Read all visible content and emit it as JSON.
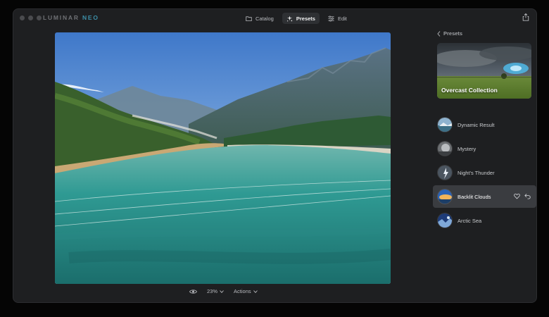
{
  "app": {
    "logo_main": "LUMINAR",
    "logo_accent": "NEO"
  },
  "topnav": {
    "items": [
      {
        "label": "Catalog",
        "icon": "folder-icon",
        "active": false
      },
      {
        "label": "Presets",
        "icon": "sparkle-icon",
        "active": true
      },
      {
        "label": "Edit",
        "icon": "sliders-icon",
        "active": false
      }
    ]
  },
  "bottombar": {
    "zoom": "23%",
    "actions_label": "Actions"
  },
  "sidebar": {
    "back_label": "Presets",
    "collection_title": "Overcast Collection",
    "presets": [
      {
        "label": "Dynamic Result",
        "selected": false
      },
      {
        "label": "Mystery",
        "selected": false
      },
      {
        "label": "Night's Thunder",
        "selected": false
      },
      {
        "label": "Backlit Clouds",
        "selected": true
      },
      {
        "label": "Arctic Sea",
        "selected": false
      }
    ]
  },
  "colors": {
    "window_bg": "#1e1f21",
    "selected_row": "#3a3c40",
    "accent_neo": "#3d8fa8"
  }
}
